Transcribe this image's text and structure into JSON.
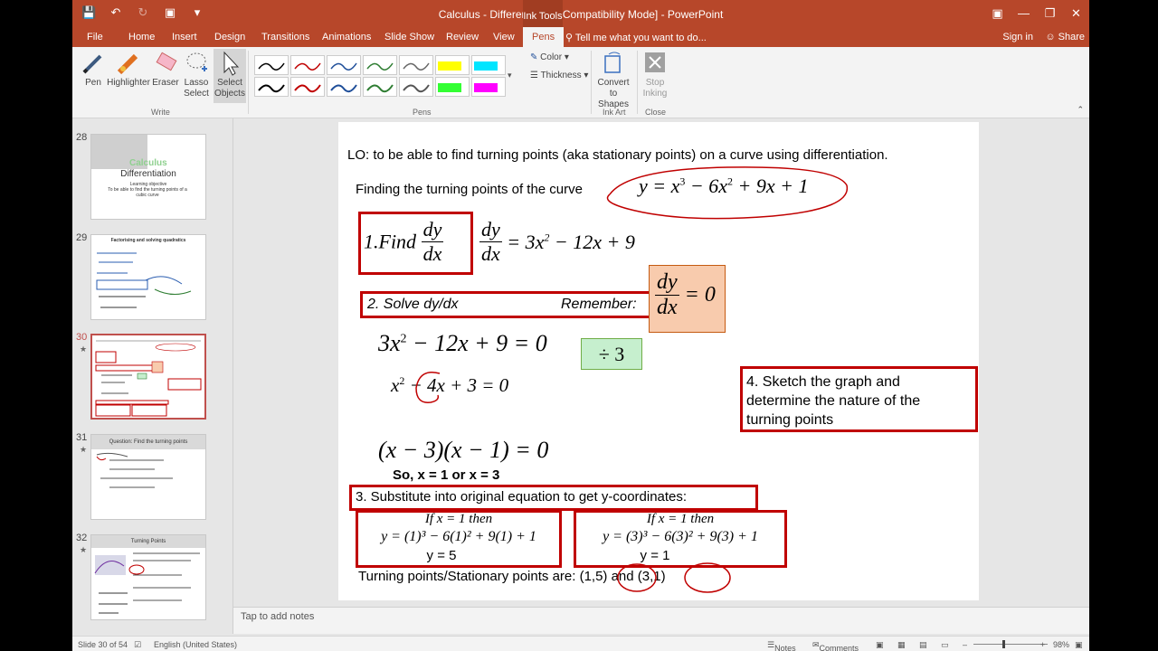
{
  "window": {
    "title": "Calculus - Differentiation [Compatibility Mode] - PowerPoint",
    "contextual_tab": "Ink Tools"
  },
  "tabs": [
    "File",
    "Home",
    "Insert",
    "Design",
    "Transitions",
    "Animations",
    "Slide Show",
    "Review",
    "View",
    "Pens"
  ],
  "active_tab": "Pens",
  "tellme": "Tell me what you want to do...",
  "signin": "Sign in",
  "share": "Share",
  "ribbon": {
    "pen": "Pen",
    "highlighter": "Highlighter",
    "eraser": "Eraser",
    "lasso1": "Lasso",
    "lasso2": "Select",
    "select1": "Select",
    "select2": "Objects",
    "group_write": "Write",
    "group_pens": "Pens",
    "color": "Color",
    "thickness": "Thickness",
    "convert1": "Convert",
    "convert2": "to Shapes",
    "group_inkart": "Ink Art",
    "stop1": "Stop",
    "stop2": "Inking",
    "group_close": "Close"
  },
  "thumbnails": [
    {
      "num": "28",
      "title": "Calculus",
      "subtitle": "Differentiation",
      "line1": "Learning objective",
      "line2": "To be able to find the turning points of a cubic curve"
    },
    {
      "num": "29",
      "title": "Factorising and solving quadratics"
    },
    {
      "num": "30",
      "title": ""
    },
    {
      "num": "31",
      "title": "Question: Find the turning points"
    },
    {
      "num": "32",
      "title": "Turning Points"
    }
  ],
  "slide": {
    "lo": "LO: to be able to find turning points (aka stationary points) on a curve using differentiation.",
    "finding": "Finding the turning points of the curve",
    "curve_y": "y = x",
    "curve_rest1": " − 6x",
    "curve_rest2": " + 9x + 1",
    "step1_label": "1.Find",
    "dy": "dy",
    "dx": "dx",
    "deriv": "= 3x",
    "deriv_rest": " − 12x + 9",
    "step2": "2. Solve dy/dx",
    "remember": "Remember:",
    "eq_zero": "= 0",
    "eq1": "3x",
    "eq1_rest": " − 12x + 9 = 0",
    "div3": "÷  3",
    "eq2a": "x",
    "eq2b": " − 4x  + 3 = 0",
    "factored": "(x − 3)(x − 1) = 0",
    "so": "So, x = 1 or x = 3",
    "step3": "3. Substitute  into original equation to get y-coordinates:",
    "sub1_head": "If  x = 1  then",
    "sub1_eq": "y = (1)³ − 6(1)² + 9(1) + 1",
    "sub1_res": "y = 5",
    "sub2_head": "If  x = 1  then",
    "sub2_eq": "y = (3)³ − 6(3)² + 9(3) + 1",
    "sub2_res": "y = 1",
    "step4": "4. Sketch the graph and determine the nature of the turning points",
    "tp_text": "Turning points/Stationary points are: ",
    "tp1": "(1,5)",
    "and": "and",
    "tp2": "(3,1)"
  },
  "notes_placeholder": "Tap to add notes",
  "status": {
    "slide_of": "Slide 30 of 54",
    "language": "English (United States)",
    "notes": "Notes",
    "comments": "Comments",
    "zoom": "98%"
  },
  "colors": {
    "accent": "#b7472a",
    "ink_red": "#c00000",
    "remember_fill": "#f8cbad",
    "div_fill": "#c6efce"
  }
}
